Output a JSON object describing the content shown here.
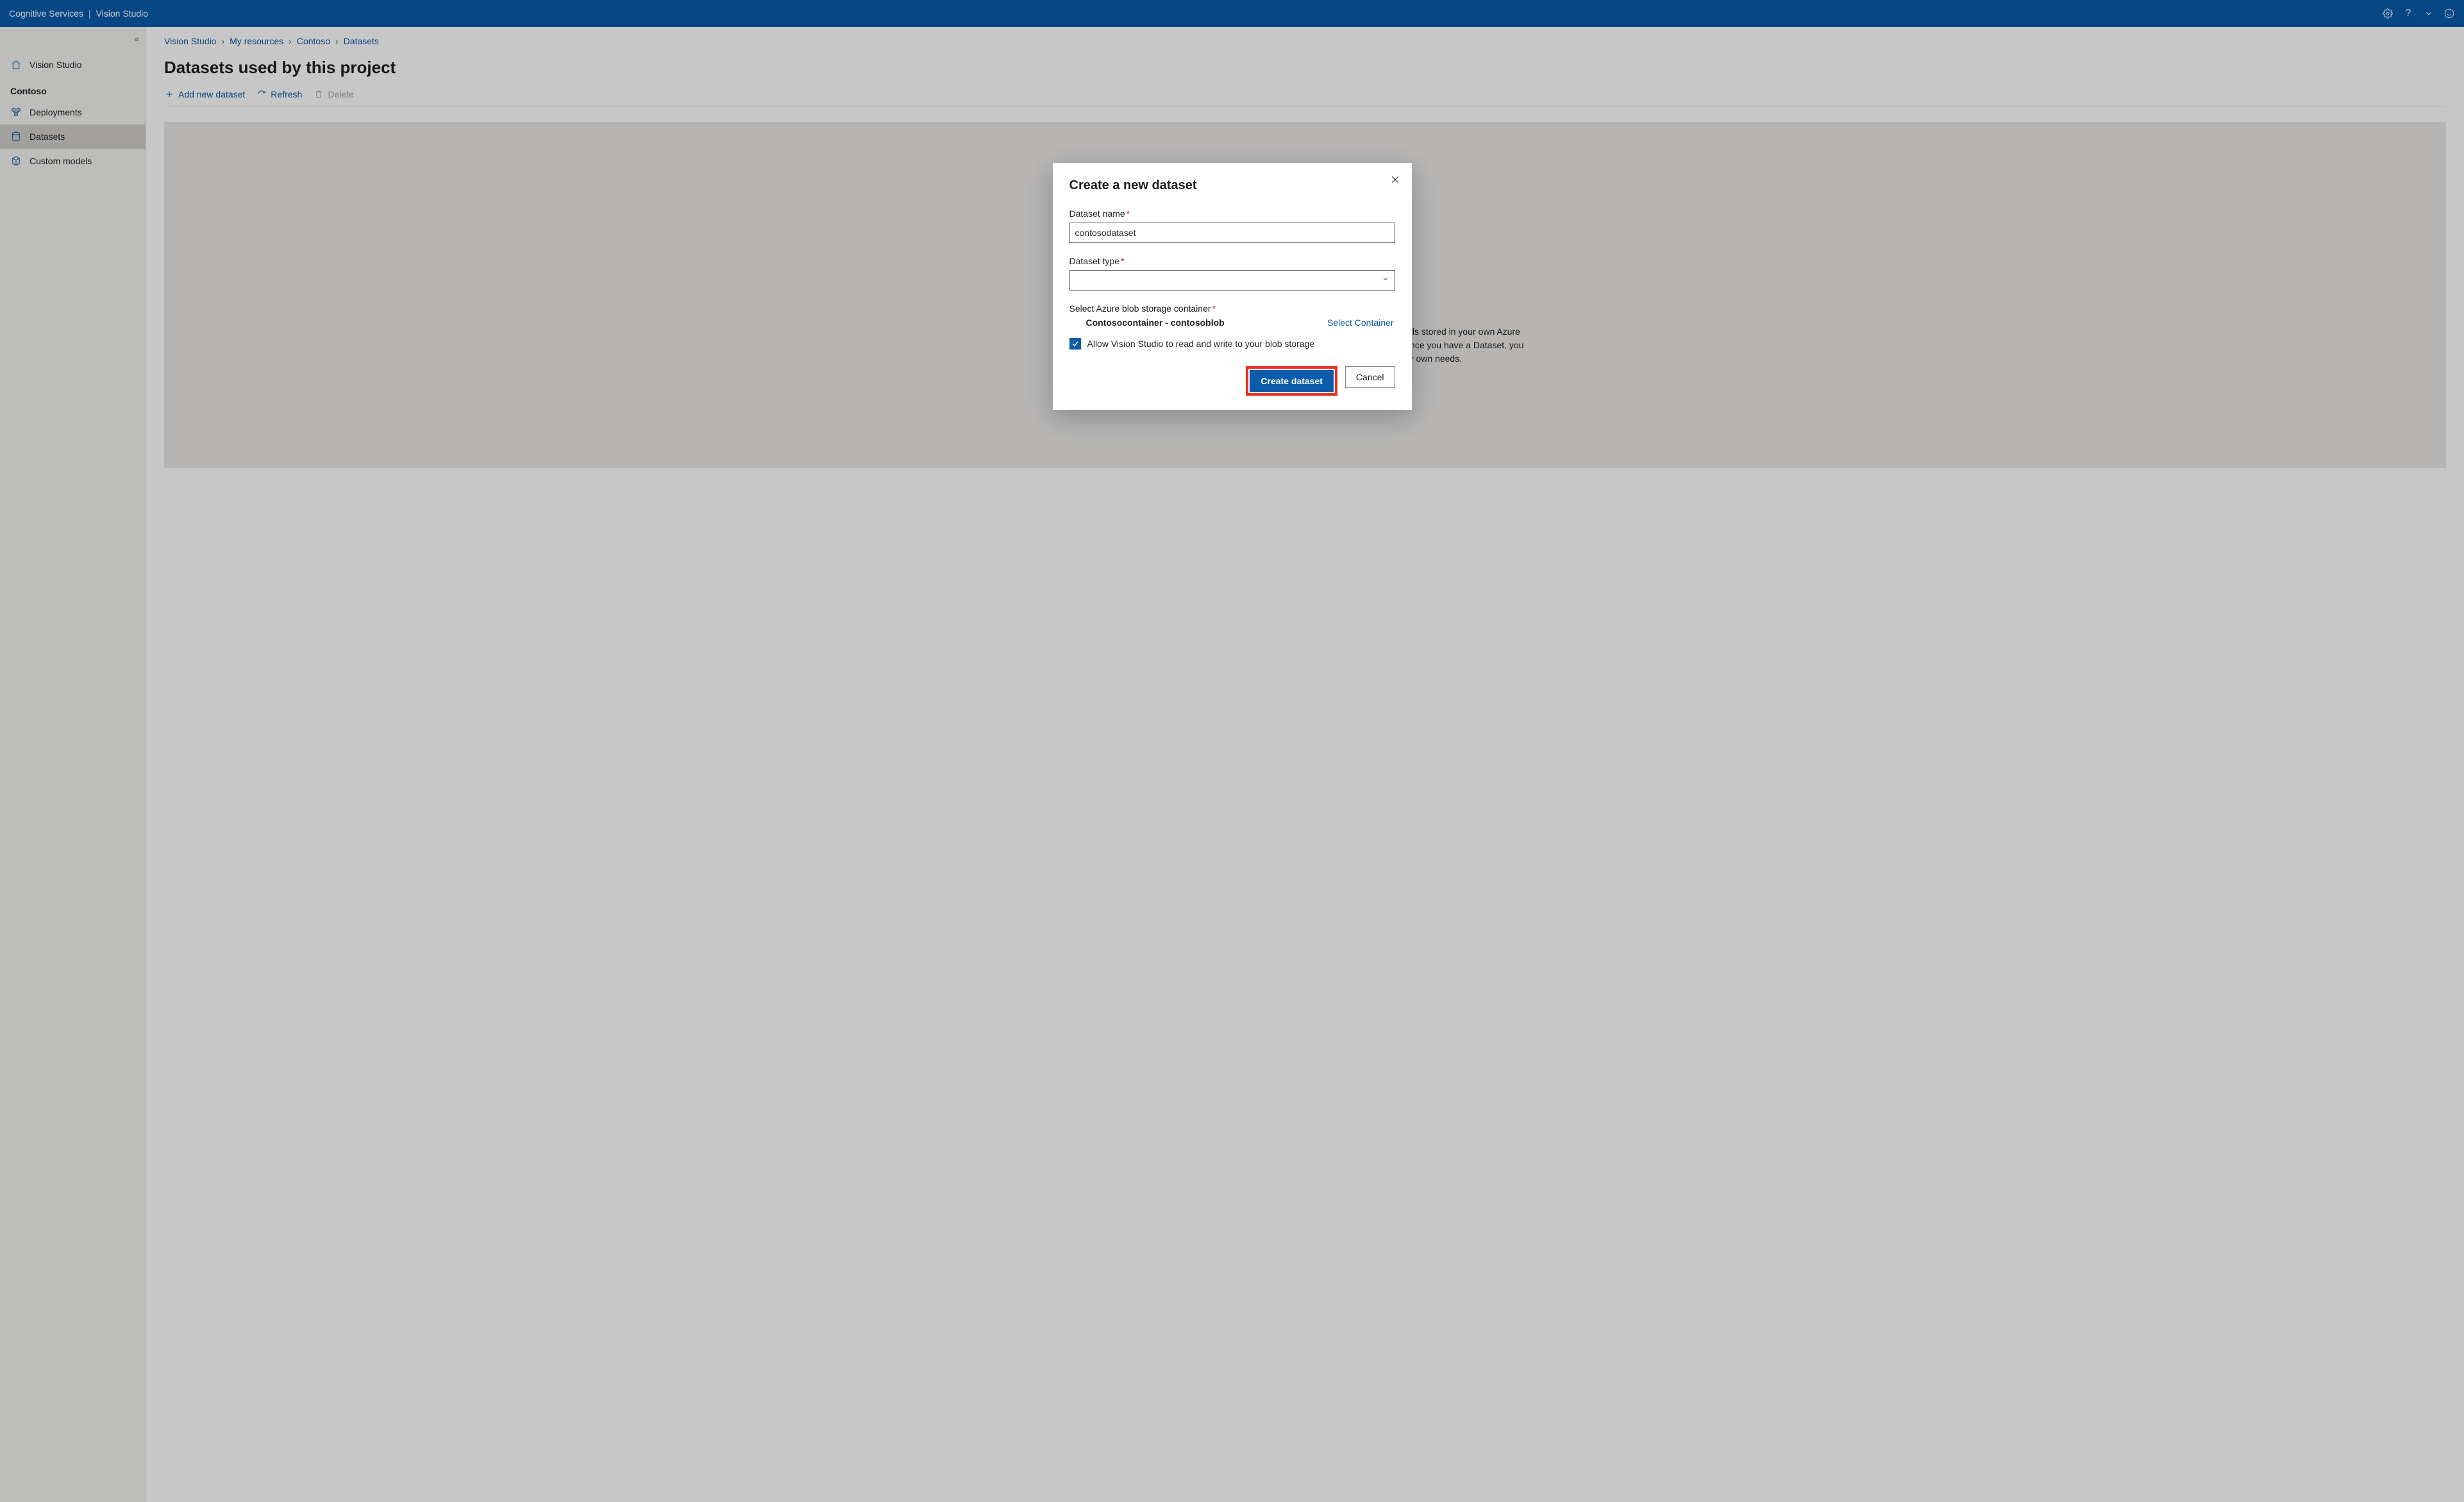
{
  "header": {
    "brand": "Cognitive Services",
    "divider": "|",
    "product": "Vision Studio",
    "icons": {
      "settings": "gear-icon",
      "help": "?",
      "feedback": "smile-icon"
    }
  },
  "sidebar": {
    "home_label": "Vision Studio",
    "project_label": "Contoso",
    "items": [
      {
        "label": "Deployments",
        "id": "deployments"
      },
      {
        "label": "Datasets",
        "id": "datasets",
        "selected": true
      },
      {
        "label": "Custom models",
        "id": "custom-models"
      }
    ]
  },
  "breadcrumb": {
    "items": [
      "Vision Studio",
      "My resources",
      "Contoso",
      "Datasets"
    ]
  },
  "page": {
    "title": "Datasets used by this project",
    "toolbar": {
      "add_label": "Add new dataset",
      "refresh_label": "Refresh",
      "delete_label": "Delete"
    },
    "empty_message": "Create a new dataset to get started. You will be able to leverage images and labels stored in your own Azure Blob to create new datasets, as well as label images using Azure ML if needed. Once you have a Dataset, you can use it to train new Computer Vision models customized to your own needs."
  },
  "modal": {
    "title": "Create a new dataset",
    "fields": {
      "name_label": "Dataset name",
      "name_value": "contosodataset",
      "type_label": "Dataset type",
      "type_value": "",
      "container_label": "Select Azure blob storage container",
      "container_name": "Contosocontainer - contosoblob",
      "select_container_link": "Select Container",
      "allow_label": "Allow Vision Studio to read and write to your blob storage",
      "allow_checked": true
    },
    "buttons": {
      "primary": "Create dataset",
      "secondary": "Cancel"
    }
  }
}
